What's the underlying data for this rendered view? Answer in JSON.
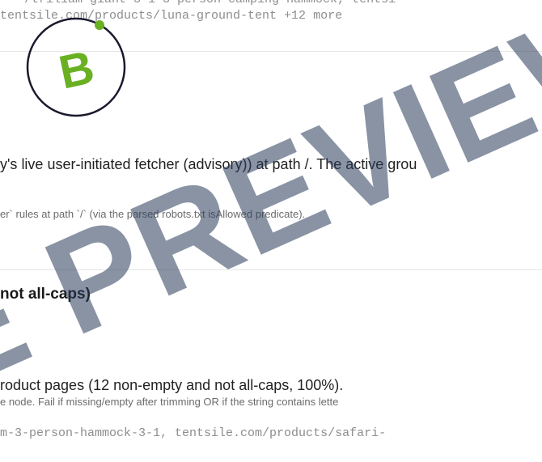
{
  "top_evidence": {
    "urls_top": "/triliam-giant-3-1-3-person-camping-hammock, tentsi",
    "urls_line": "tentsile.com/products/luna-ground-tent +12 more"
  },
  "logo": {
    "letter": "B",
    "ring_color": "#1a1a2e",
    "accent_color": "#6ab023"
  },
  "finding": {
    "text": "y's live user-initiated fetcher (advisory)) at path /. The active grou",
    "detail": "er` rules at path `/` (via the parsed robots.txt isAllowed predicate)."
  },
  "section": {
    "title": "not all-caps)"
  },
  "check": {
    "text": "roduct pages (12 non-empty and not all-caps, 100%).",
    "detail": "e node. Fail if missing/empty after trimming OR if the string contains lette",
    "urls": "m-3-person-hammock-3-1, tentsile.com/products/safari-"
  },
  "watermark": {
    "text": "E PREVIEW"
  }
}
